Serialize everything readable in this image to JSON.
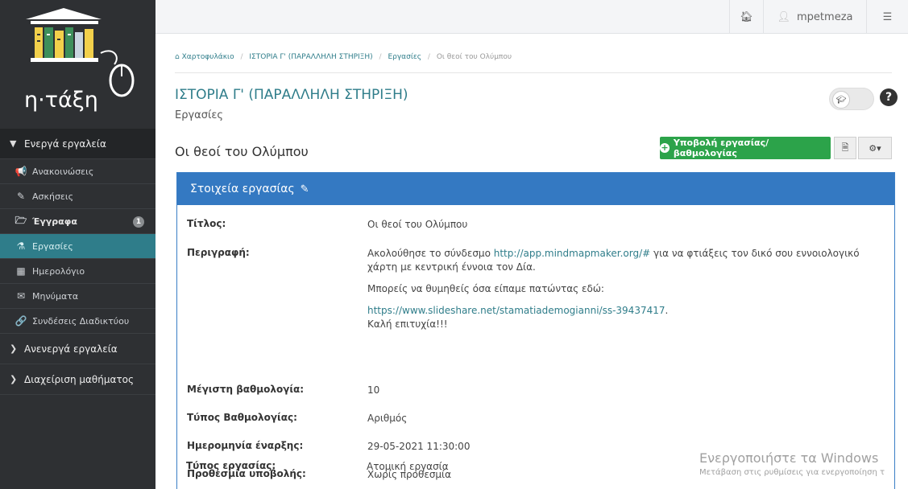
{
  "logo": {
    "text": "η·τάξη"
  },
  "sidebar": {
    "sections": [
      {
        "label": "Ενεργά εργαλεία"
      },
      {
        "label": "Ανενεργά εργαλεία"
      },
      {
        "label": "Διαχείριση μαθήματος"
      }
    ],
    "items": [
      {
        "label": "Ανακοινώσεις",
        "icon": "megaphone-icon"
      },
      {
        "label": "Ασκήσεις",
        "icon": "edit-icon"
      },
      {
        "label": "Έγγραφα",
        "icon": "folder-icon",
        "badge": "1"
      },
      {
        "label": "Εργασίες",
        "icon": "flask-icon"
      },
      {
        "label": "Ημερολόγιο",
        "icon": "calendar-icon"
      },
      {
        "label": "Μηνύματα",
        "icon": "envelope-icon"
      },
      {
        "label": "Συνδέσεις Διαδικτύου",
        "icon": "link-icon"
      }
    ]
  },
  "topbar": {
    "username": "mpetmeza"
  },
  "breadcrumb": {
    "items": [
      "Χαρτοφυλάκιο",
      "ΙΣΤΟΡΙΑ Γ' (ΠΑΡΑΛΛΗΛΗ ΣΤΗΡΙΞΗ)",
      "Εργασίες",
      "Οι θεοί του Ολύμπου"
    ]
  },
  "page": {
    "course_title": "ΙΣΤΟΡΙΑ Γ' (ΠΑΡΑΛΛΗΛΗ ΣΤΗΡΙΞΗ)",
    "subtitle": "Εργασίες",
    "assignment_title": "Οι θεοί του Ολύμπου",
    "submit_button": "Υποβολή εργασίας/βαθμολογίας",
    "help": "?"
  },
  "panel": {
    "heading": "Στοιχεία εργασίας",
    "fields": {
      "title_label": "Τίτλος:",
      "title_value": "Οι θεοί του Ολύμπου",
      "desc_label": "Περιγραφή:",
      "desc_text1": "Ακολούθησε το σύνδεσμο ",
      "desc_link1": "http://app.mindmapmaker.org/#",
      "desc_text2": " για να φτιάξεις τον δικό σου εννοιολογικό χάρτη με κεντρική έννοια τον Δία.",
      "desc_line2": "Μπορείς να θυμηθείς όσα είπαμε πατώντας εδώ:",
      "desc_link2": "https://www.slideshare.net/stamatiademogianni/ss-39437417",
      "desc_link2_tail": ".",
      "desc_line3": "Καλή επιτυχία!!!",
      "max_grade_label": "Μέγιστη βαθμολογία:",
      "max_grade_value": "10",
      "grade_type_label": "Τύπος Βαθμολογίας:",
      "grade_type_value": "Αριθμός",
      "start_label": "Ημερομηνία έναρξης:",
      "start_value": "29-05-2021 11:30:00",
      "deadline_label": "Προθεσμία υποβολής:",
      "deadline_value": "Χωρίς προθεσμία",
      "type_label": "Τύπος εργασίας:",
      "type_value": "Ατομική εργασία"
    }
  },
  "watermark": {
    "line1": "Ενεργοποιήστε τα Windows",
    "line2": "Μετάβαση στις ρυθμίσεις για ενεργοποίηση τ"
  }
}
